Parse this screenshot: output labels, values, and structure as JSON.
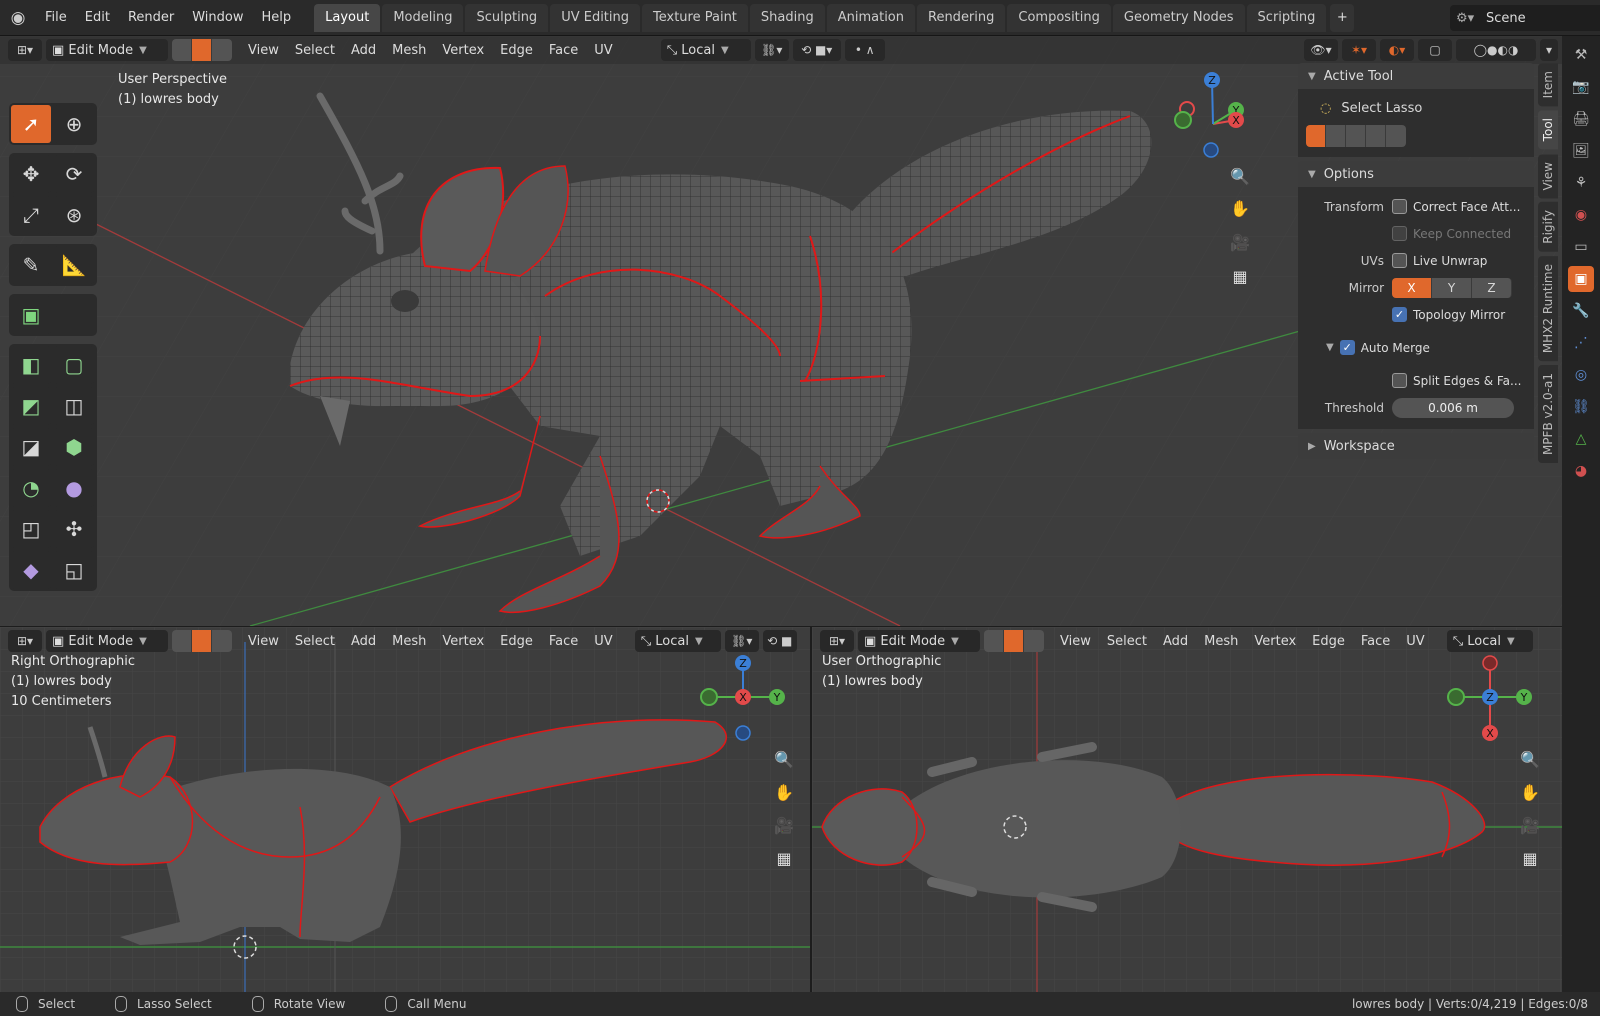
{
  "topbar": {
    "menus": [
      "File",
      "Edit",
      "Render",
      "Window",
      "Help"
    ],
    "workspaces": [
      "Layout",
      "Modeling",
      "Sculpting",
      "UV Editing",
      "Texture Paint",
      "Shading",
      "Animation",
      "Rendering",
      "Compositing",
      "Geometry Nodes",
      "Scripting"
    ],
    "active_workspace": "Layout",
    "add_tab": "+",
    "scene": "Scene"
  },
  "header": {
    "mode": "Edit Mode",
    "menus": [
      "View",
      "Select",
      "Add",
      "Mesh",
      "Vertex",
      "Edge",
      "Face",
      "UV"
    ],
    "pivot": "Local"
  },
  "viewport_main": {
    "view_name": "User Perspective",
    "object": "(1) lowres body"
  },
  "viewport_left": {
    "view_name": "Right Orthographic",
    "object": "(1) lowres body",
    "scale": "10 Centimeters"
  },
  "viewport_right": {
    "view_name": "User Orthographic",
    "object": "(1) lowres body"
  },
  "axes": {
    "x": "X",
    "y": "Y",
    "z": "Z"
  },
  "npanel": {
    "active_tool_title": "Active Tool",
    "tool_name": "Select Lasso",
    "options_title": "Options",
    "transform_label": "Transform",
    "correct_face": "Correct Face Att...",
    "keep_connected": "Keep Connected",
    "uvs_label": "UVs",
    "live_unwrap": "Live Unwrap",
    "mirror_label": "Mirror",
    "mirror_axes": [
      "X",
      "Y",
      "Z"
    ],
    "topology_mirror": "Topology Mirror",
    "auto_merge": "Auto Merge",
    "split_edges": "Split Edges & Fa...",
    "threshold_label": "Threshold",
    "threshold_value": "0.006 m",
    "workspace_title": "Workspace"
  },
  "sidetabs": [
    "Item",
    "Tool",
    "View",
    "Rigify",
    "MHX2 Runtime",
    "MPFB v2.0-a1"
  ],
  "status": {
    "select": "Select",
    "lasso": "Lasso Select",
    "rotate": "Rotate View",
    "call_menu": "Call Menu",
    "stats": "lowres body | Verts:0/4,219 | Edges:0/8"
  },
  "colors": {
    "accent": "#e0682c",
    "seam": "#e01818",
    "axis_x": "#e34a4a",
    "axis_y": "#55b34a",
    "axis_z": "#3b7fd6"
  }
}
